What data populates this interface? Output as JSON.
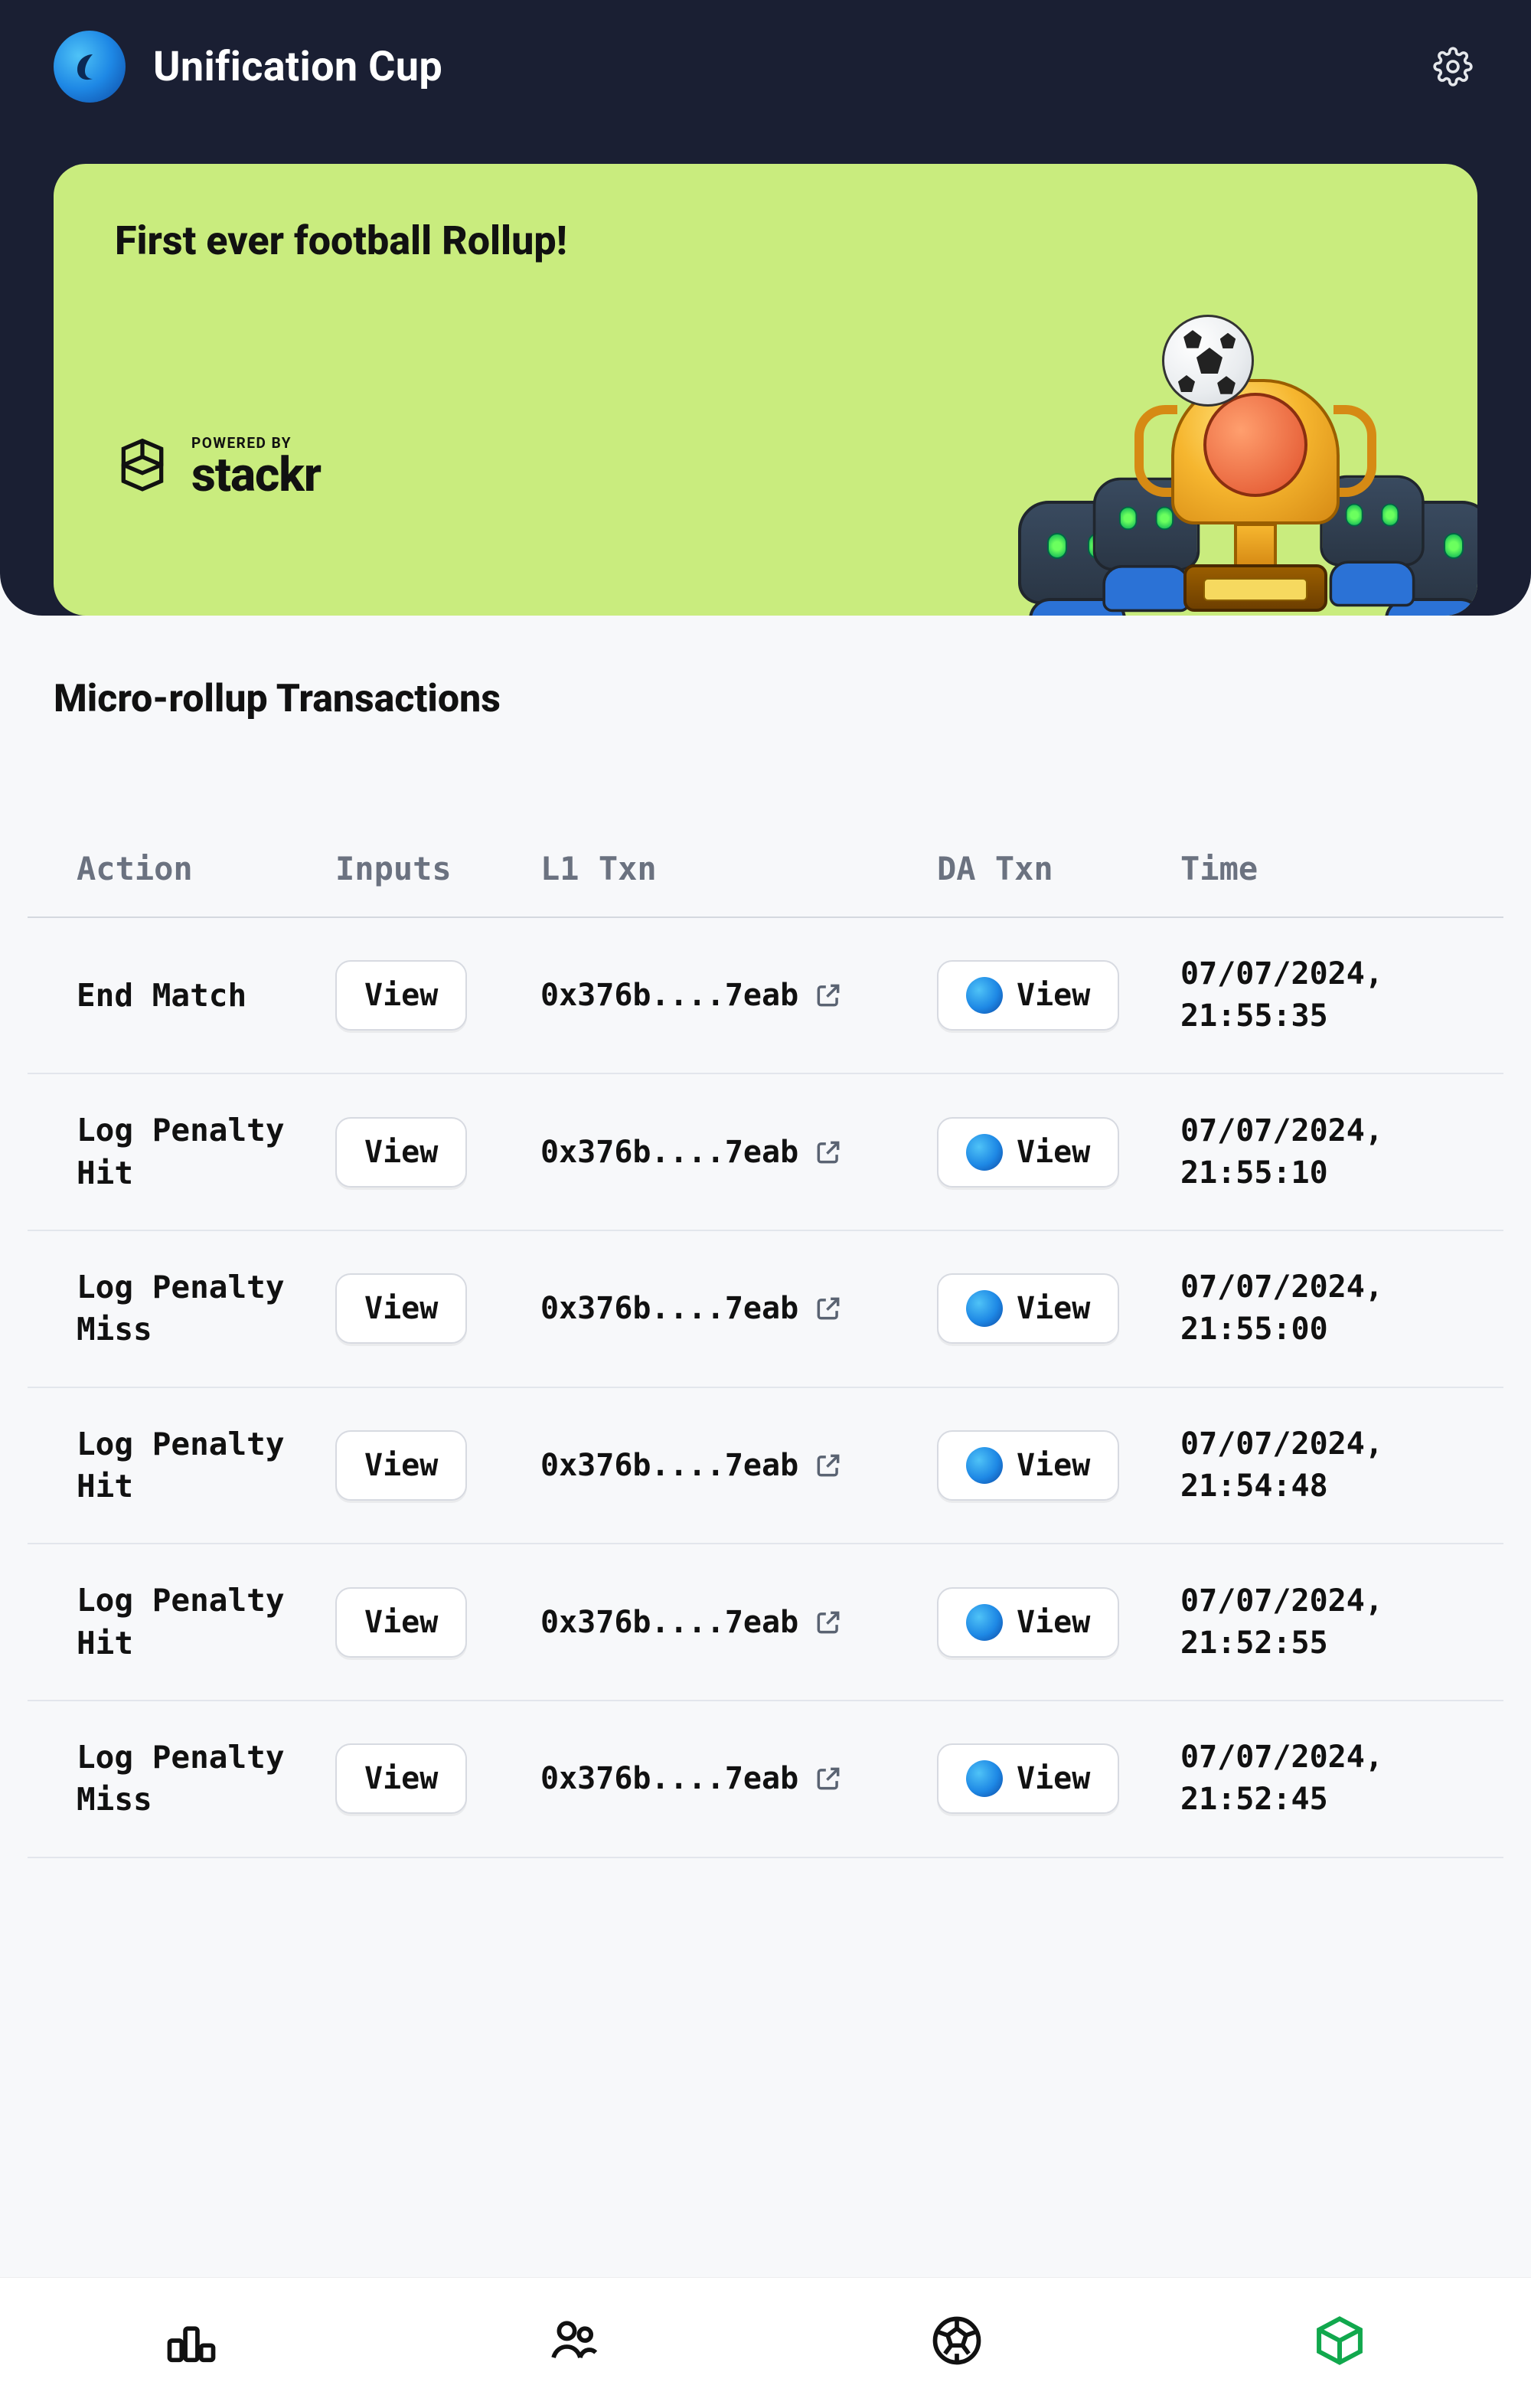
{
  "header": {
    "title": "Unification Cup"
  },
  "banner": {
    "headline": "First ever football Rollup!",
    "powered_label": "POWERED BY",
    "powered_brand": "stackr"
  },
  "section": {
    "title": "Micro-rollup Transactions"
  },
  "table": {
    "headers": {
      "action": "Action",
      "inputs": "Inputs",
      "l1": "L1 Txn",
      "da": "DA Txn",
      "time": "Time"
    },
    "view_label": "View",
    "rows": [
      {
        "action": "End Match",
        "l1": "0x376b....7eab",
        "time": "07/07/2024, 21:55:35"
      },
      {
        "action": "Log Penalty Hit",
        "l1": "0x376b....7eab",
        "time": "07/07/2024, 21:55:10"
      },
      {
        "action": "Log Penalty Miss",
        "l1": "0x376b....7eab",
        "time": "07/07/2024, 21:55:00"
      },
      {
        "action": "Log Penalty Hit",
        "l1": "0x376b....7eab",
        "time": "07/07/2024, 21:54:48"
      },
      {
        "action": "Log Penalty Hit",
        "l1": "0x376b....7eab",
        "time": "07/07/2024, 21:52:55"
      },
      {
        "action": "Log Penalty Miss",
        "l1": "0x376b....7eab",
        "time": "07/07/2024, 21:52:45"
      }
    ]
  }
}
